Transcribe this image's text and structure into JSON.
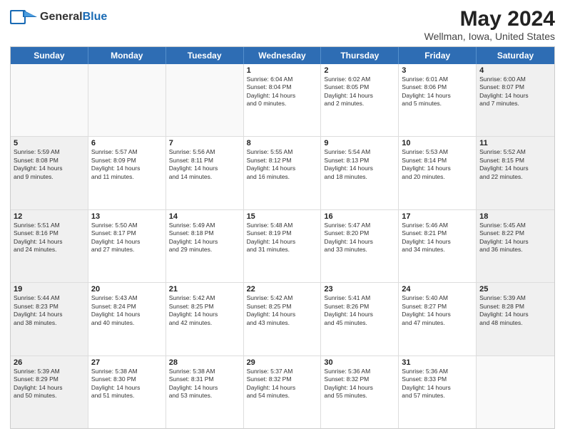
{
  "header": {
    "logo_general": "General",
    "logo_blue": "Blue",
    "title": "May 2024",
    "subtitle": "Wellman, Iowa, United States"
  },
  "days_of_week": [
    "Sunday",
    "Monday",
    "Tuesday",
    "Wednesday",
    "Thursday",
    "Friday",
    "Saturday"
  ],
  "weeks": [
    [
      {
        "day": "",
        "lines": [],
        "empty": true
      },
      {
        "day": "",
        "lines": [],
        "empty": true
      },
      {
        "day": "",
        "lines": [],
        "empty": true
      },
      {
        "day": "1",
        "lines": [
          "Sunrise: 6:04 AM",
          "Sunset: 8:04 PM",
          "Daylight: 14 hours",
          "and 0 minutes."
        ],
        "empty": false,
        "shaded": false
      },
      {
        "day": "2",
        "lines": [
          "Sunrise: 6:02 AM",
          "Sunset: 8:05 PM",
          "Daylight: 14 hours",
          "and 2 minutes."
        ],
        "empty": false,
        "shaded": false
      },
      {
        "day": "3",
        "lines": [
          "Sunrise: 6:01 AM",
          "Sunset: 8:06 PM",
          "Daylight: 14 hours",
          "and 5 minutes."
        ],
        "empty": false,
        "shaded": false
      },
      {
        "day": "4",
        "lines": [
          "Sunrise: 6:00 AM",
          "Sunset: 8:07 PM",
          "Daylight: 14 hours",
          "and 7 minutes."
        ],
        "empty": false,
        "shaded": true
      }
    ],
    [
      {
        "day": "5",
        "lines": [
          "Sunrise: 5:59 AM",
          "Sunset: 8:08 PM",
          "Daylight: 14 hours",
          "and 9 minutes."
        ],
        "empty": false,
        "shaded": true
      },
      {
        "day": "6",
        "lines": [
          "Sunrise: 5:57 AM",
          "Sunset: 8:09 PM",
          "Daylight: 14 hours",
          "and 11 minutes."
        ],
        "empty": false,
        "shaded": false
      },
      {
        "day": "7",
        "lines": [
          "Sunrise: 5:56 AM",
          "Sunset: 8:11 PM",
          "Daylight: 14 hours",
          "and 14 minutes."
        ],
        "empty": false,
        "shaded": false
      },
      {
        "day": "8",
        "lines": [
          "Sunrise: 5:55 AM",
          "Sunset: 8:12 PM",
          "Daylight: 14 hours",
          "and 16 minutes."
        ],
        "empty": false,
        "shaded": false
      },
      {
        "day": "9",
        "lines": [
          "Sunrise: 5:54 AM",
          "Sunset: 8:13 PM",
          "Daylight: 14 hours",
          "and 18 minutes."
        ],
        "empty": false,
        "shaded": false
      },
      {
        "day": "10",
        "lines": [
          "Sunrise: 5:53 AM",
          "Sunset: 8:14 PM",
          "Daylight: 14 hours",
          "and 20 minutes."
        ],
        "empty": false,
        "shaded": false
      },
      {
        "day": "11",
        "lines": [
          "Sunrise: 5:52 AM",
          "Sunset: 8:15 PM",
          "Daylight: 14 hours",
          "and 22 minutes."
        ],
        "empty": false,
        "shaded": true
      }
    ],
    [
      {
        "day": "12",
        "lines": [
          "Sunrise: 5:51 AM",
          "Sunset: 8:16 PM",
          "Daylight: 14 hours",
          "and 24 minutes."
        ],
        "empty": false,
        "shaded": true
      },
      {
        "day": "13",
        "lines": [
          "Sunrise: 5:50 AM",
          "Sunset: 8:17 PM",
          "Daylight: 14 hours",
          "and 27 minutes."
        ],
        "empty": false,
        "shaded": false
      },
      {
        "day": "14",
        "lines": [
          "Sunrise: 5:49 AM",
          "Sunset: 8:18 PM",
          "Daylight: 14 hours",
          "and 29 minutes."
        ],
        "empty": false,
        "shaded": false
      },
      {
        "day": "15",
        "lines": [
          "Sunrise: 5:48 AM",
          "Sunset: 8:19 PM",
          "Daylight: 14 hours",
          "and 31 minutes."
        ],
        "empty": false,
        "shaded": false
      },
      {
        "day": "16",
        "lines": [
          "Sunrise: 5:47 AM",
          "Sunset: 8:20 PM",
          "Daylight: 14 hours",
          "and 33 minutes."
        ],
        "empty": false,
        "shaded": false
      },
      {
        "day": "17",
        "lines": [
          "Sunrise: 5:46 AM",
          "Sunset: 8:21 PM",
          "Daylight: 14 hours",
          "and 34 minutes."
        ],
        "empty": false,
        "shaded": false
      },
      {
        "day": "18",
        "lines": [
          "Sunrise: 5:45 AM",
          "Sunset: 8:22 PM",
          "Daylight: 14 hours",
          "and 36 minutes."
        ],
        "empty": false,
        "shaded": true
      }
    ],
    [
      {
        "day": "19",
        "lines": [
          "Sunrise: 5:44 AM",
          "Sunset: 8:23 PM",
          "Daylight: 14 hours",
          "and 38 minutes."
        ],
        "empty": false,
        "shaded": true
      },
      {
        "day": "20",
        "lines": [
          "Sunrise: 5:43 AM",
          "Sunset: 8:24 PM",
          "Daylight: 14 hours",
          "and 40 minutes."
        ],
        "empty": false,
        "shaded": false
      },
      {
        "day": "21",
        "lines": [
          "Sunrise: 5:42 AM",
          "Sunset: 8:25 PM",
          "Daylight: 14 hours",
          "and 42 minutes."
        ],
        "empty": false,
        "shaded": false
      },
      {
        "day": "22",
        "lines": [
          "Sunrise: 5:42 AM",
          "Sunset: 8:25 PM",
          "Daylight: 14 hours",
          "and 43 minutes."
        ],
        "empty": false,
        "shaded": false
      },
      {
        "day": "23",
        "lines": [
          "Sunrise: 5:41 AM",
          "Sunset: 8:26 PM",
          "Daylight: 14 hours",
          "and 45 minutes."
        ],
        "empty": false,
        "shaded": false
      },
      {
        "day": "24",
        "lines": [
          "Sunrise: 5:40 AM",
          "Sunset: 8:27 PM",
          "Daylight: 14 hours",
          "and 47 minutes."
        ],
        "empty": false,
        "shaded": false
      },
      {
        "day": "25",
        "lines": [
          "Sunrise: 5:39 AM",
          "Sunset: 8:28 PM",
          "Daylight: 14 hours",
          "and 48 minutes."
        ],
        "empty": false,
        "shaded": true
      }
    ],
    [
      {
        "day": "26",
        "lines": [
          "Sunrise: 5:39 AM",
          "Sunset: 8:29 PM",
          "Daylight: 14 hours",
          "and 50 minutes."
        ],
        "empty": false,
        "shaded": true
      },
      {
        "day": "27",
        "lines": [
          "Sunrise: 5:38 AM",
          "Sunset: 8:30 PM",
          "Daylight: 14 hours",
          "and 51 minutes."
        ],
        "empty": false,
        "shaded": false
      },
      {
        "day": "28",
        "lines": [
          "Sunrise: 5:38 AM",
          "Sunset: 8:31 PM",
          "Daylight: 14 hours",
          "and 53 minutes."
        ],
        "empty": false,
        "shaded": false
      },
      {
        "day": "29",
        "lines": [
          "Sunrise: 5:37 AM",
          "Sunset: 8:32 PM",
          "Daylight: 14 hours",
          "and 54 minutes."
        ],
        "empty": false,
        "shaded": false
      },
      {
        "day": "30",
        "lines": [
          "Sunrise: 5:36 AM",
          "Sunset: 8:32 PM",
          "Daylight: 14 hours",
          "and 55 minutes."
        ],
        "empty": false,
        "shaded": false
      },
      {
        "day": "31",
        "lines": [
          "Sunrise: 5:36 AM",
          "Sunset: 8:33 PM",
          "Daylight: 14 hours",
          "and 57 minutes."
        ],
        "empty": false,
        "shaded": false
      },
      {
        "day": "",
        "lines": [],
        "empty": true,
        "shaded": true
      }
    ]
  ]
}
